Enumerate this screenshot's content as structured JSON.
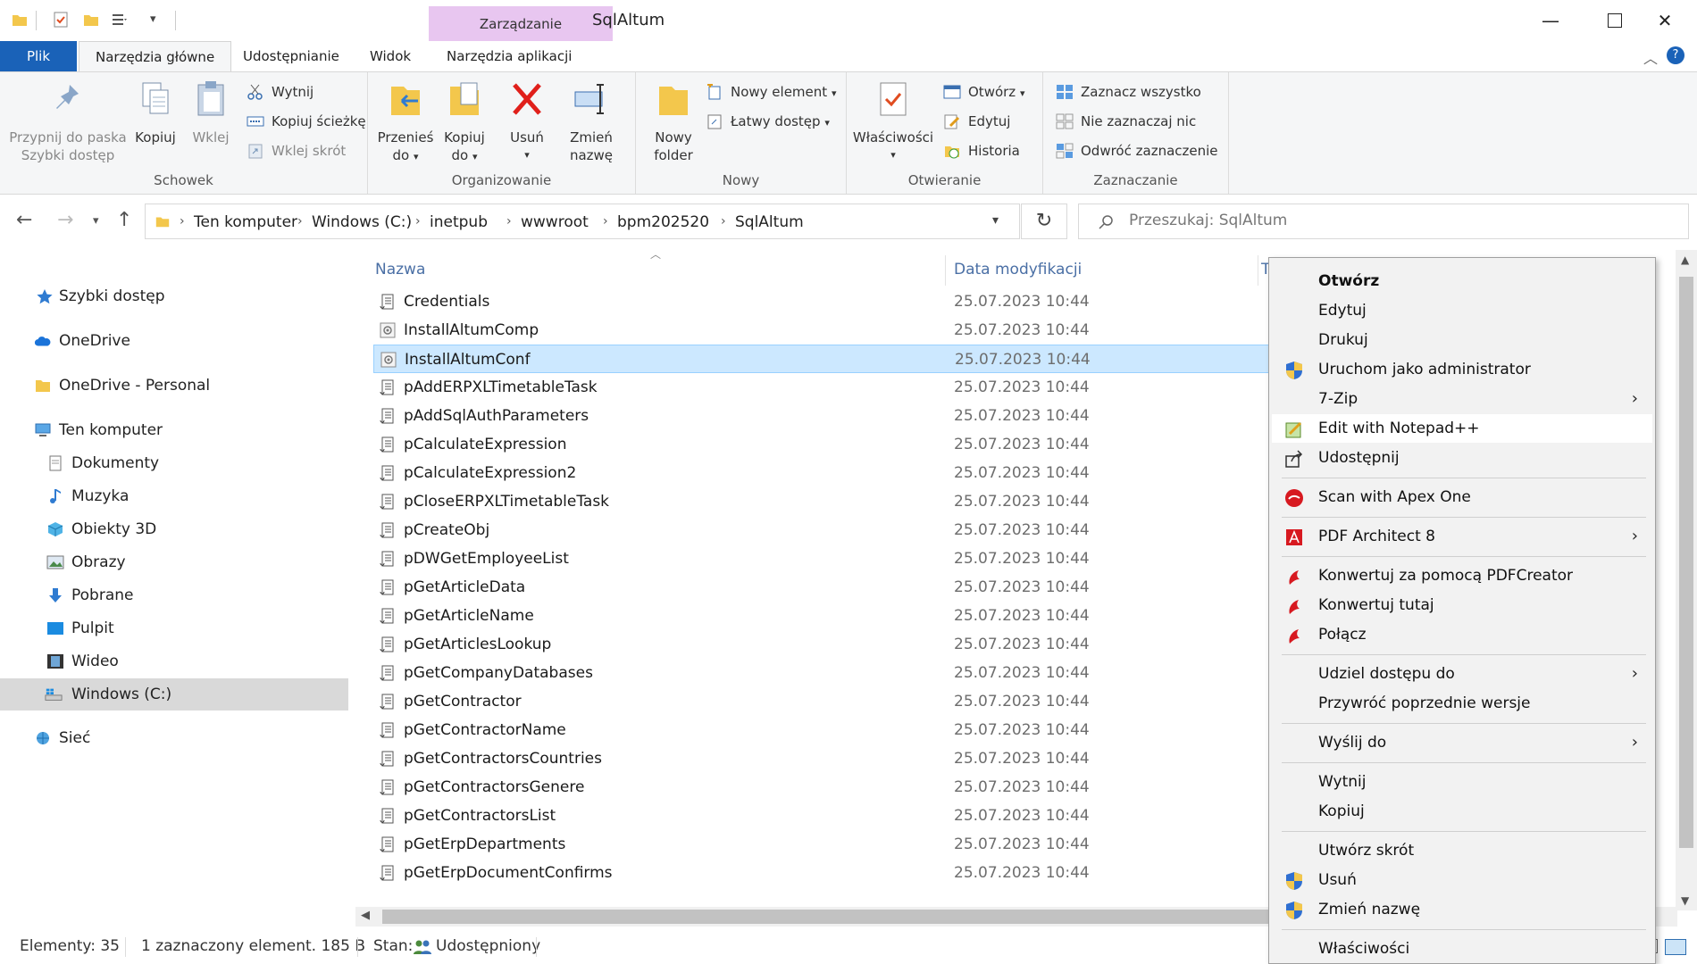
{
  "window": {
    "title": "SqlAltum",
    "context_tab_group": "Zarządzanie"
  },
  "tabs": {
    "file": "Plik",
    "home": "Narzędzia główne",
    "share": "Udostępnianie",
    "view": "Widok",
    "app_tools": "Narzędzia aplikacji"
  },
  "ribbon": {
    "clipboard": {
      "label": "Schowek",
      "pin_line1": "Przypnij do paska",
      "pin_line2": "Szybki dostęp",
      "copy": "Kopiuj",
      "paste": "Wklej",
      "cut": "Wytnij",
      "copy_path": "Kopiuj ścieżkę",
      "paste_shortcut": "Wklej skrót"
    },
    "organize": {
      "label": "Organizowanie",
      "move_line1": "Przenieś",
      "move_line2": "do",
      "copy_line1": "Kopiuj",
      "copy_line2": "do",
      "delete": "Usuń",
      "rename_line1": "Zmień",
      "rename_line2": "nazwę"
    },
    "new": {
      "label": "Nowy",
      "new_folder_line1": "Nowy",
      "new_folder_line2": "folder",
      "new_item": "Nowy element",
      "easy_access": "Łatwy dostęp"
    },
    "open": {
      "label": "Otwieranie",
      "properties": "Właściwości",
      "open": "Otwórz",
      "edit": "Edytuj",
      "history": "Historia"
    },
    "select": {
      "label": "Zaznaczanie",
      "select_all": "Zaznacz wszystko",
      "select_none": "Nie zaznaczaj nic",
      "invert": "Odwróć zaznaczenie"
    }
  },
  "address": {
    "crumbs": [
      "Ten komputer",
      "Windows (C:)",
      "inetpub",
      "wwwroot",
      "bpm202520",
      "SqlAltum"
    ],
    "search_placeholder": "Przeszukaj: SqlAltum"
  },
  "navpane": {
    "quick_access": "Szybki dostęp",
    "onedrive": "OneDrive",
    "onedrive_personal": "OneDrive - Personal",
    "this_pc": "Ten komputer",
    "documents": "Dokumenty",
    "music": "Muzyka",
    "objects3d": "Obiekty 3D",
    "pictures": "Obrazy",
    "downloads": "Pobrane",
    "desktop": "Pulpit",
    "videos": "Wideo",
    "windows_c": "Windows (C:)",
    "network": "Sieć"
  },
  "filelist": {
    "col_name": "Nazwa",
    "col_date": "Data modyfikacji",
    "col_type": "T",
    "files": [
      {
        "name": "Credentials",
        "date": "25.07.2023 10:44"
      },
      {
        "name": "InstallAltumComp",
        "date": "25.07.2023 10:44"
      },
      {
        "name": "InstallAltumConf",
        "date": "25.07.2023 10:44"
      },
      {
        "name": "pAddERPXLTimetableTask",
        "date": "25.07.2023 10:44"
      },
      {
        "name": "pAddSqlAuthParameters",
        "date": "25.07.2023 10:44"
      },
      {
        "name": "pCalculateExpression",
        "date": "25.07.2023 10:44"
      },
      {
        "name": "pCalculateExpression2",
        "date": "25.07.2023 10:44"
      },
      {
        "name": "pCloseERPXLTimetableTask",
        "date": "25.07.2023 10:44"
      },
      {
        "name": "pCreateObj",
        "date": "25.07.2023 10:44"
      },
      {
        "name": "pDWGetEmployeeList",
        "date": "25.07.2023 10:44"
      },
      {
        "name": "pGetArticleData",
        "date": "25.07.2023 10:44"
      },
      {
        "name": "pGetArticleName",
        "date": "25.07.2023 10:44"
      },
      {
        "name": "pGetArticlesLookup",
        "date": "25.07.2023 10:44"
      },
      {
        "name": "pGetCompanyDatabases",
        "date": "25.07.2023 10:44"
      },
      {
        "name": "pGetContractor",
        "date": "25.07.2023 10:44"
      },
      {
        "name": "pGetContractorName",
        "date": "25.07.2023 10:44"
      },
      {
        "name": "pGetContractorsCountries",
        "date": "25.07.2023 10:44"
      },
      {
        "name": "pGetContractorsGenere",
        "date": "25.07.2023 10:44"
      },
      {
        "name": "pGetContractorsList",
        "date": "25.07.2023 10:44"
      },
      {
        "name": "pGetErpDepartments",
        "date": "25.07.2023 10:44"
      },
      {
        "name": "pGetErpDocumentConfirms",
        "date": "25.07.2023 10:44"
      }
    ]
  },
  "status": {
    "items": "Elementy: 35",
    "selection": "1 zaznaczony element. 185 B",
    "state_label": "Stan:",
    "state_value": "Udostępniony"
  },
  "context_menu": {
    "open": "Otwórz",
    "edit": "Edytuj",
    "print": "Drukuj",
    "run_as_admin": "Uruchom jako administrator",
    "sevenzip": "7-Zip",
    "notepadpp": "Edit with Notepad++",
    "share": "Udostępnij",
    "apex": "Scan with Apex One",
    "pdf_architect": "PDF Architect 8",
    "pdfcreator_convert": "Konwertuj za pomocą PDFCreator",
    "convert_here": "Konwertuj tutaj",
    "merge": "Połącz",
    "give_access": "Udziel dostępu do",
    "restore": "Przywróć poprzednie wersje",
    "send_to": "Wyślij do",
    "cut": "Wytnij",
    "copy": "Kopiuj",
    "create_shortcut": "Utwórz skrót",
    "delete": "Usuń",
    "rename": "Zmień nazwę",
    "properties": "Właściwości"
  },
  "colors": {
    "file_tab": "#1a62b8",
    "context_group": "#e8c6f0",
    "selection": "#cce8ff",
    "header_text": "#4a6fa5"
  }
}
